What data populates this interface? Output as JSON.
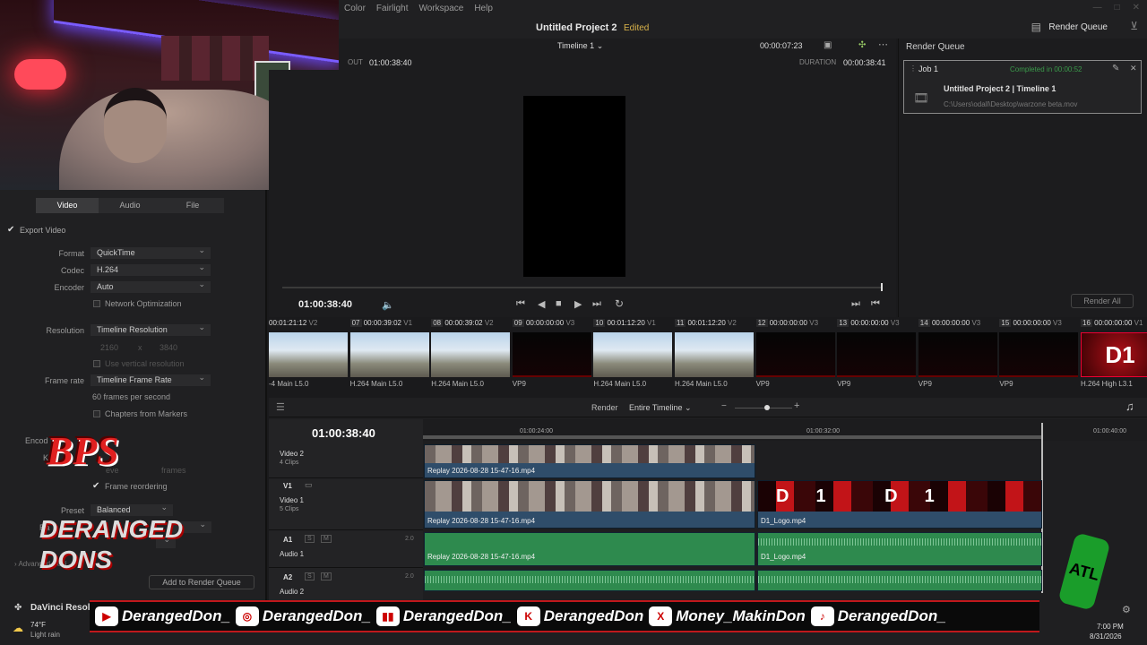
{
  "menu": [
    "Color",
    "Fairlight",
    "Workspace",
    "Help"
  ],
  "project": {
    "title": "Untitled Project 2",
    "status": "Edited",
    "render_queue_btn": "Render Queue"
  },
  "viewer": {
    "timeline_name": "Timeline 1",
    "out_label": "OUT",
    "out_tc": "01:00:38:40",
    "duration_label": "DURATION",
    "duration_tc": "00:00:38:41",
    "current_tc_top": "00:00:07:23",
    "current_tc": "01:00:38:40"
  },
  "render_queue": {
    "header": "Render Queue",
    "job_label": "Job 1",
    "job_status": "Completed in 00:00:52",
    "job_title": "Untitled Project 2 | Timeline 1",
    "job_path": "C:\\Users\\odall\\Desktop\\warzone beta.mov",
    "render_all": "Render All"
  },
  "settings": {
    "tabs": [
      "Video",
      "Audio",
      "File"
    ],
    "export_video": "Export Video",
    "format_label": "Format",
    "format": "QuickTime",
    "codec_label": "Codec",
    "codec": "H.264",
    "encoder_label": "Encoder",
    "encoder": "Auto",
    "network_opt": "Network Optimization",
    "resolution_label": "Resolution",
    "resolution": "Timeline Resolution",
    "res_w": "2160",
    "res_x": "x",
    "res_h": "3840",
    "vertical_res": "Use vertical resolution",
    "framerate_label": "Frame rate",
    "framerate": "Timeline Frame Rate",
    "fps_text": "60 frames per second",
    "chapters": "Chapters from Markers",
    "encode_label": "Encod",
    "k_label": "K",
    "every_text": "eve",
    "frames_text": "frames",
    "frame_reorder": "Frame reordering",
    "preset_label": "Preset",
    "preset": "Balanced",
    "ra_label": "Ra",
    "advanced": "Advanced Setti",
    "add_queue": "Add to Render Queue"
  },
  "clips": [
    {
      "num": "",
      "tc": "00:01:21:12",
      "track": "V2",
      "cap": "-4 Main L5.0",
      "kind": "game"
    },
    {
      "num": "07",
      "tc": "00:00:39:02",
      "track": "V1",
      "cap": "H.264 Main L5.0",
      "kind": "game"
    },
    {
      "num": "08",
      "tc": "00:00:39:02",
      "track": "V2",
      "cap": "H.264 Main L5.0",
      "kind": "game"
    },
    {
      "num": "09",
      "tc": "00:00:00:00",
      "track": "V3",
      "cap": "VP9",
      "kind": "dark"
    },
    {
      "num": "10",
      "tc": "00:01:12:20",
      "track": "V1",
      "cap": "H.264 Main L5.0",
      "kind": "game"
    },
    {
      "num": "11",
      "tc": "00:01:12:20",
      "track": "V2",
      "cap": "H.264 Main L5.0",
      "kind": "game"
    },
    {
      "num": "12",
      "tc": "00:00:00:00",
      "track": "V3",
      "cap": "VP9",
      "kind": "dark"
    },
    {
      "num": "13",
      "tc": "00:00:00:00",
      "track": "V3",
      "cap": "VP9",
      "kind": "dark"
    },
    {
      "num": "14",
      "tc": "00:00:00:00",
      "track": "V3",
      "cap": "VP9",
      "kind": "dark"
    },
    {
      "num": "15",
      "tc": "00:00:00:00",
      "track": "V3",
      "cap": "VP9",
      "kind": "dark"
    },
    {
      "num": "16",
      "tc": "00:00:00:00",
      "track": "V1",
      "cap": "H.264 High L3.1",
      "kind": "logo",
      "logo": "D1"
    }
  ],
  "timeline": {
    "render_label": "Render",
    "render_range": "Entire Timeline",
    "tc": "01:00:38:40",
    "ruler": [
      "01:00:24:00",
      "01:00:32:00",
      "01:00:40:00"
    ],
    "tracks": [
      {
        "id": "",
        "name": "Video 2",
        "sub": "4 Clips"
      },
      {
        "id": "V1",
        "name": "Video 1",
        "sub": "5 Clips"
      },
      {
        "id": "A1",
        "name": "Audio 1",
        "level": "2.0"
      },
      {
        "id": "A2",
        "name": "Audio 2",
        "level": "2.0"
      }
    ],
    "clip_replay": "Replay 2026-08-28 15-47-16.mp4",
    "clip_logo": "D1_Logo.mp4",
    "logo_text": "D1 D1 D1 D1 D1"
  },
  "taskbar": {
    "app": "DaVinci Resolve",
    "weather_temp": "74°F",
    "weather_desc": "Light rain",
    "time": "7:00 PM",
    "date": "8/31/2026"
  },
  "overlay": {
    "bps": "BPS",
    "socials": [
      {
        "icon": "youtube-icon",
        "glyph": "▶",
        "handle": "DerangedDon_"
      },
      {
        "icon": "instagram-icon",
        "glyph": "◎",
        "handle": "DerangedDon_"
      },
      {
        "icon": "twitch-icon",
        "glyph": "▮▮",
        "handle": "DerangedDon_"
      },
      {
        "icon": "kick-icon",
        "glyph": "K",
        "handle": "DerangedDon"
      },
      {
        "icon": "x-icon",
        "glyph": "X",
        "handle": "Money_MakinDon"
      },
      {
        "icon": "tiktok-icon",
        "glyph": "♪",
        "handle": "DerangedDon_"
      }
    ]
  }
}
